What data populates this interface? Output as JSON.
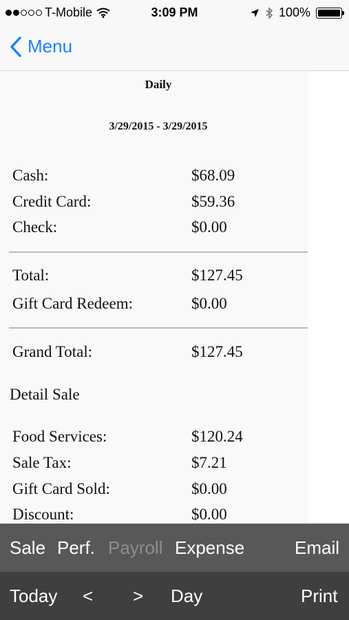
{
  "status_bar": {
    "carrier": "T-Mobile",
    "time": "3:09 PM",
    "battery": "100%"
  },
  "nav": {
    "back_label": "Menu"
  },
  "report": {
    "title": "Daily",
    "date_range": "3/29/2015 - 3/29/2015",
    "payments": [
      {
        "label": "Cash:",
        "value": "$68.09"
      },
      {
        "label": "Credit Card:",
        "value": "$59.36"
      },
      {
        "label": "Check:",
        "value": "$0.00"
      }
    ],
    "totals": [
      {
        "label": "Total:",
        "value": "$127.45"
      },
      {
        "label": "Gift Card Redeem:",
        "value": "$0.00"
      }
    ],
    "grand_total": {
      "label": "Grand Total:",
      "value": "$127.45"
    },
    "detail_heading": "Detail Sale",
    "details": [
      {
        "label": "Food Services:",
        "value": "$120.24"
      },
      {
        "label": "Sale Tax:",
        "value": "$7.21"
      },
      {
        "label": "Gift Card Sold:",
        "value": "$0.00"
      },
      {
        "label": "Discount:",
        "value": "$0.00"
      }
    ]
  },
  "toolbar": {
    "sale": "Sale",
    "perf": "Perf.",
    "payroll": "Payroll",
    "expense": "Expense",
    "email": "Email",
    "today": "Today",
    "prev": "<",
    "next": ">",
    "period": "Day",
    "print": "Print"
  },
  "colors": {
    "accent": "#1a82fb",
    "toolbar_top": "#585858",
    "toolbar_bottom": "#3f3f3f"
  }
}
